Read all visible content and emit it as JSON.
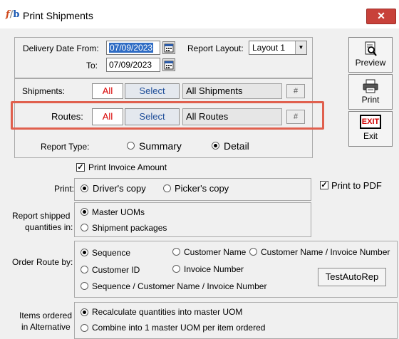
{
  "window": {
    "icon_text_f": "f",
    "icon_text_sep": "/",
    "icon_text_b": "b",
    "title": "Print Shipments",
    "close_glyph": "✕"
  },
  "dates": {
    "from_label": "Delivery Date From:",
    "from_value": "07/09/2023",
    "to_label": "To:",
    "to_value": "07/09/2023"
  },
  "report_layout": {
    "label": "Report Layout:",
    "value": "Layout 1"
  },
  "shipments": {
    "label": "Shipments:",
    "all_label": "All",
    "select_label": "Select",
    "value": "All Shipments",
    "hash_label": "#"
  },
  "routes": {
    "label": "Routes:",
    "all_label": "All",
    "select_label": "Select",
    "value": "All Routes",
    "hash_label": "#"
  },
  "report_type": {
    "label": "Report Type:",
    "options": [
      "Summary",
      "Detail"
    ],
    "selected": "Detail"
  },
  "print_invoice_amount": {
    "label": "Print Invoice Amount",
    "checked": true
  },
  "print": {
    "label": "Print:",
    "options": [
      "Driver's copy",
      "Picker's copy"
    ],
    "selected": "Driver's copy"
  },
  "print_to_pdf": {
    "label": "Print to PDF",
    "checked": true
  },
  "report_shipped": {
    "label_line1": "Report  shipped",
    "label_line2": "quantities in:",
    "options": [
      "Master UOMs",
      "Shipment packages"
    ],
    "selected": "Master UOMs"
  },
  "order_route": {
    "label": "Order Route by:",
    "options": [
      "Sequence",
      "Customer Name",
      "Customer Name / Invoice Number",
      "Customer ID",
      "Invoice Number",
      "Sequence / Customer Name / Invoice Number"
    ],
    "selected": "Sequence"
  },
  "test_autorep_label": "TestAutoRep",
  "items_ordered": {
    "label_line1": "Items ordered",
    "label_line2": "in Alternative",
    "options": [
      "Recalculate quantities into master UOM",
      "Combine into 1 master UOM per item ordered"
    ],
    "selected": "Recalculate quantities into master UOM"
  },
  "side_buttons": {
    "preview": "Preview",
    "print": "Print",
    "exit": "Exit",
    "exit_sign": "EXIT"
  }
}
